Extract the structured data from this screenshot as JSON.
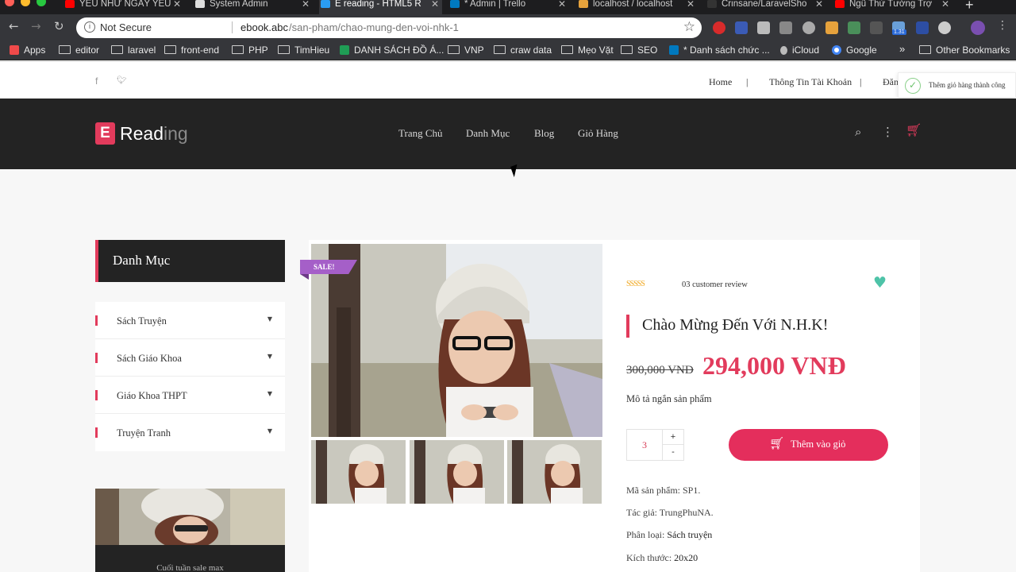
{
  "browser": {
    "tabs": [
      {
        "title": "YÊU NHƯ NGÀY YÊU",
        "favicon": "youtube-icon",
        "color": "#ff0000"
      },
      {
        "title": "System Admin",
        "favicon": "page-icon",
        "color": "#dddddd"
      },
      {
        "title": "E reading - HTML5 R",
        "favicon": "ereading-icon",
        "color": "#2a9df4"
      },
      {
        "title": "* Admin | Trello",
        "favicon": "trello-icon",
        "color": "#0079bf"
      },
      {
        "title": "localhost / localhost",
        "favicon": "phpmyadmin-icon",
        "color": "#e6a23c"
      },
      {
        "title": "Crinsane/LaravelSho",
        "favicon": "github-icon",
        "color": "#333333"
      },
      {
        "title": "Ngũ Thứ Tướng Trợ",
        "favicon": "youtube-icon",
        "color": "#ff0000"
      }
    ],
    "not_secure": "Not Secure",
    "url_host": "ebook.abc",
    "url_path": "/san-pham/chao-mung-den-voi-nhk-1",
    "bookmarks": [
      {
        "label": "Apps",
        "type": "apps"
      },
      {
        "label": "editor",
        "type": "folder"
      },
      {
        "label": "laravel",
        "type": "folder"
      },
      {
        "label": "front-end",
        "type": "folder"
      },
      {
        "label": "PHP",
        "type": "folder"
      },
      {
        "label": "TimHieu",
        "type": "folder"
      },
      {
        "label": "DANH SÁCH ĐỒ Á...",
        "type": "sheet"
      },
      {
        "label": "VNP",
        "type": "folder"
      },
      {
        "label": "craw data",
        "type": "folder"
      },
      {
        "label": "Mẹo Vặt",
        "type": "folder"
      },
      {
        "label": "SEO",
        "type": "folder"
      },
      {
        "label": "* Danh sách chức ...",
        "type": "trello"
      },
      {
        "label": "iCloud",
        "type": "apple"
      },
      {
        "label": "Google",
        "type": "google"
      },
      {
        "label": "»",
        "type": "more"
      },
      {
        "label": "Other Bookmarks",
        "type": "folder"
      }
    ],
    "ext_badge": "1.31"
  },
  "site": {
    "top_links": [
      "Home",
      "Thông Tin Tài Khoản",
      "Đăng"
    ],
    "toast": "Thêm giỏ hàng thành công",
    "logo_mark": "E",
    "logo_bold": "Read",
    "logo_dim": "ing",
    "nav": [
      "Trang Chủ",
      "Danh Mục",
      "Blog",
      "Giỏ Hàng"
    ],
    "accent": "#e23b5c",
    "sidebar": {
      "title": "Danh Mục",
      "categories": [
        "Sách Truyện",
        "Sách Giáo Khoa",
        "Giáo Khoa THPT",
        "Truyện Tranh"
      ],
      "promo_caption": "Cuối tuần sale max"
    },
    "product": {
      "badge": "SALE!",
      "rating_stars": "SSSSS",
      "reviews": "03 customer review",
      "title": "Chào Mừng Đến Với N.H.K!",
      "old_price": "300,000 VNĐ",
      "new_price": "294,000 VNĐ",
      "short_desc": "Mô tả ngắn sản phẩm",
      "quantity": "3",
      "plus": "+",
      "minus": "-",
      "add_to_cart": "Thêm vào giỏ",
      "meta": [
        {
          "label": "Mã sản phẩm: ",
          "value": "SP1."
        },
        {
          "label": "Tác giả: ",
          "value": "TrungPhuNA."
        },
        {
          "label": "Phân loại: ",
          "value": "Sách truyện"
        },
        {
          "label": "Kích thước: ",
          "value": "20x20"
        }
      ]
    }
  }
}
